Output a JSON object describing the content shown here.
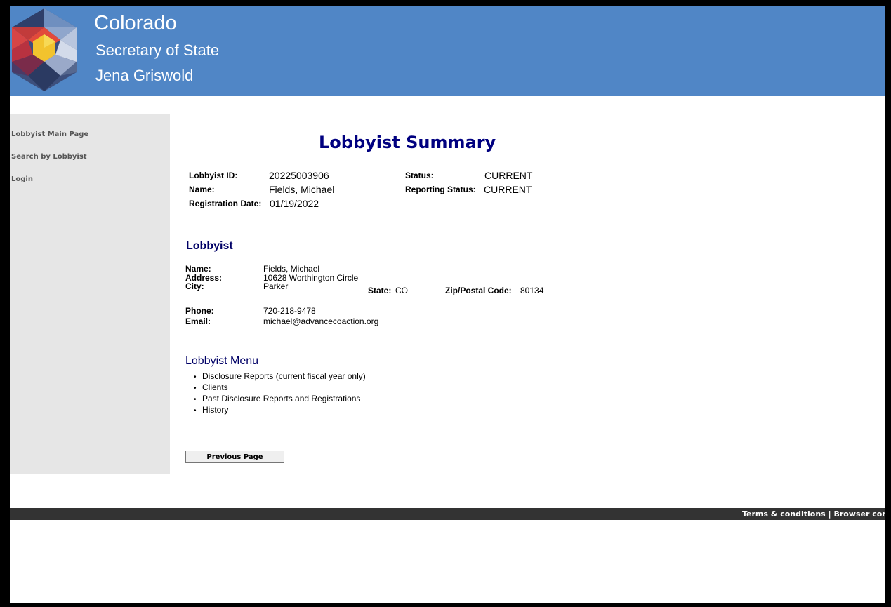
{
  "header": {
    "state": "Colorado",
    "office": "Secretary of State",
    "official": "Jena Griswold",
    "background_color": "#5086c6"
  },
  "sidebar": {
    "items": [
      {
        "label": "Lobbyist Main Page"
      },
      {
        "label": "Search by Lobbyist"
      },
      {
        "label": "Login"
      }
    ]
  },
  "summary": {
    "title": "Lobbyist Summary",
    "id_label": "Lobbyist ID:",
    "id_value": "20225003906",
    "name_label": "Name:",
    "name_value": "Fields, Michael",
    "reg_date_label": "Registration Date:",
    "reg_date_value": "01/19/2022",
    "status_label": "Status:",
    "status_value": "CURRENT",
    "reporting_label": "Reporting Status:",
    "reporting_value": "CURRENT"
  },
  "lobbyist": {
    "heading": "Lobbyist",
    "name_label": "Name:",
    "name_value": "Fields, Michael",
    "address_label": "Address:",
    "address_value": "10628 Worthington Circle",
    "city_label": "City:",
    "city_value": "Parker",
    "state_label": "State:",
    "state_value": "CO",
    "zip_label": "Zip/Postal Code:",
    "zip_value": "80134",
    "phone_label": "Phone:",
    "phone_value": "720-218-9478",
    "email_label": "Email:",
    "email_value": "michael@advancecoaction.org"
  },
  "menu": {
    "heading": "Lobbyist Menu",
    "items": [
      {
        "label": "Disclosure Reports (current fiscal year only)"
      },
      {
        "label": "Clients"
      },
      {
        "label": "Past Disclosure Reports and Registrations"
      },
      {
        "label": "History"
      }
    ]
  },
  "buttons": {
    "previous": "Previous Page"
  },
  "footer": {
    "terms": "Terms & conditions",
    "separator": "|",
    "browser": "Browser compatibility"
  }
}
